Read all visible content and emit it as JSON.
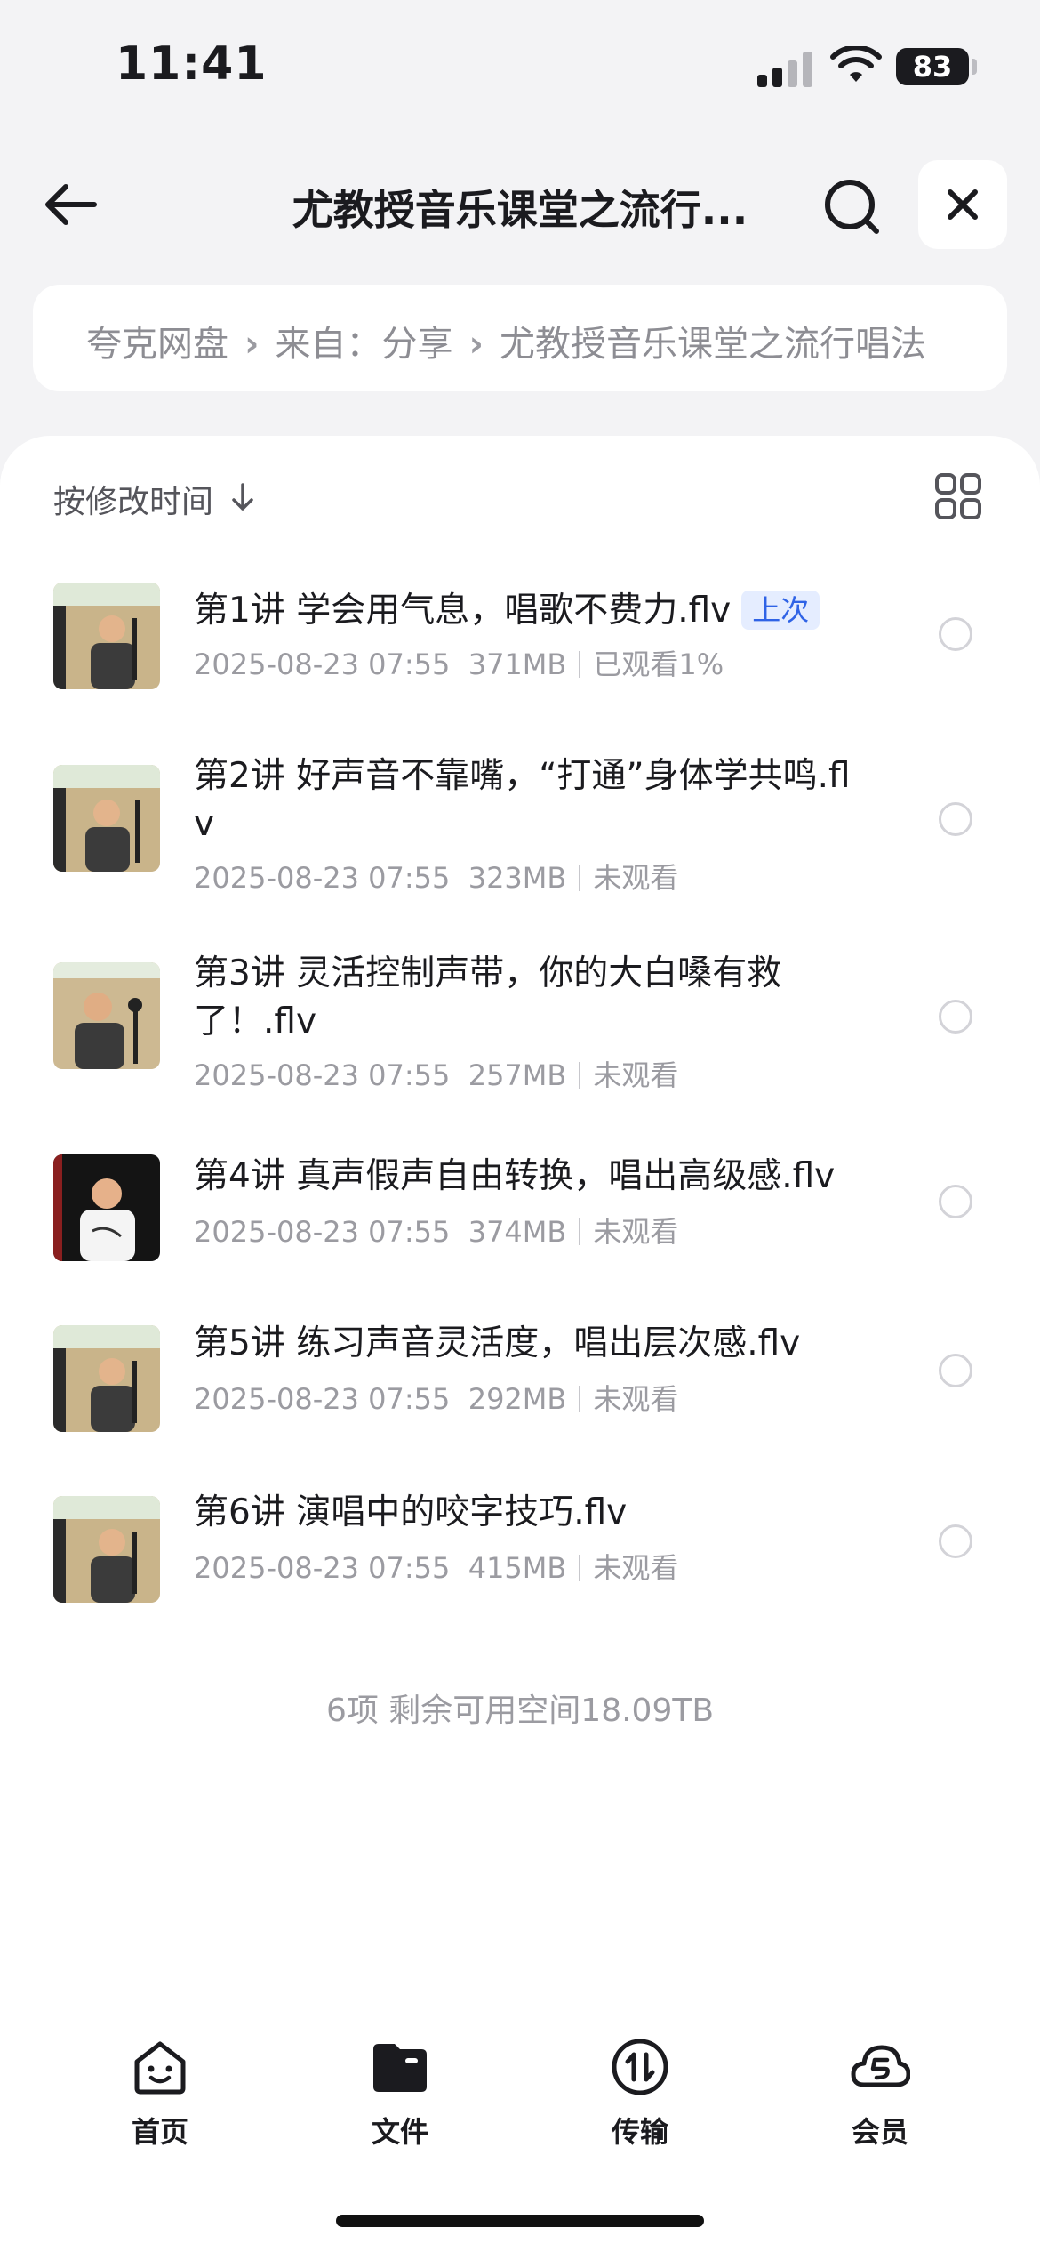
{
  "status_bar": {
    "time": "11:41",
    "battery": "83"
  },
  "header": {
    "title": "尤教授音乐课堂之流行..."
  },
  "breadcrumb": {
    "items": [
      "夸克网盘",
      "来自：分享",
      "尤教授音乐课堂之流行唱法"
    ]
  },
  "toolbar": {
    "sort_label": "按修改时间",
    "sort_direction_icon": "arrow-down-icon",
    "view_icon": "grid-view-icon"
  },
  "files": [
    {
      "name": "第1讲 学会用气息，唱歌不费力.flv",
      "badge": "上次",
      "date": "2025-08-23 07:55",
      "size": "371MB",
      "status": "已观看1%"
    },
    {
      "name": "第2讲 好声音不靠嘴，“打通”身体学共鸣.flv",
      "date": "2025-08-23 07:55",
      "size": "323MB",
      "status": "未观看"
    },
    {
      "name": "第3讲 灵活控制声带，你的大白嗓有救了！.flv",
      "date": "2025-08-23 07:55",
      "size": "257MB",
      "status": "未观看"
    },
    {
      "name": "第4讲 真声假声自由转换，唱出高级感.flv",
      "date": "2025-08-23 07:55",
      "size": "374MB",
      "status": "未观看"
    },
    {
      "name": "第5讲 练习声音灵活度，唱出层次感.flv",
      "date": "2025-08-23 07:55",
      "size": "292MB",
      "status": "未观看"
    },
    {
      "name": "第6讲 演唱中的咬字技巧.flv",
      "date": "2025-08-23 07:55",
      "size": "415MB",
      "status": "未观看"
    }
  ],
  "summary": "6项 剩余可用空间18.09TB",
  "tabs": [
    {
      "label": "首页",
      "icon": "home-face-icon"
    },
    {
      "label": "文件",
      "icon": "folder-icon"
    },
    {
      "label": "传输",
      "icon": "transfer-icon"
    },
    {
      "label": "会员",
      "icon": "cloud-member-icon"
    }
  ],
  "colors": {
    "badge_bg": "#e5edff",
    "badge_text": "#2f63e6",
    "sheet_bg": "#ffffff",
    "page_bg": "#f3f3f5"
  }
}
